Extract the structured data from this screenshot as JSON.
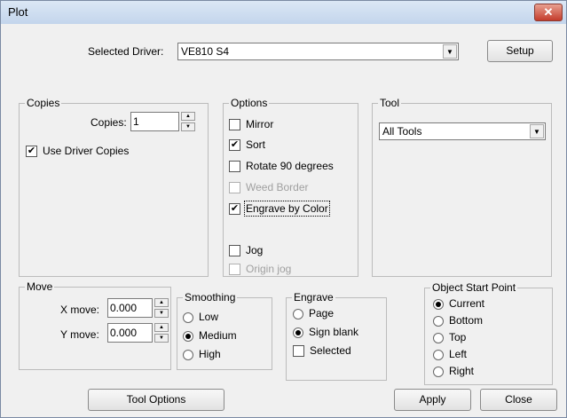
{
  "window": {
    "title": "Plot",
    "close_glyph": "✕"
  },
  "driver": {
    "label": "Selected Driver:",
    "value": "VE810 S4",
    "setup_label": "Setup"
  },
  "copies": {
    "group_label": "Copies",
    "copies_label": "Copies:",
    "copies_value": "1",
    "use_driver_copies_label": "Use Driver Copies",
    "use_driver_copies_checked": true
  },
  "options": {
    "group_label": "Options",
    "mirror": "Mirror",
    "sort": "Sort",
    "rotate": "Rotate 90 degrees",
    "weed_border": "Weed Border",
    "engrave_by_color": "Engrave by Color",
    "jog": "Jog",
    "origin_jog": "Origin jog"
  },
  "tool": {
    "group_label": "Tool",
    "value": "All Tools"
  },
  "move": {
    "group_label": "Move",
    "x_label": "X move:",
    "x_value": "0.000",
    "y_label": "Y move:",
    "y_value": "0.000"
  },
  "smoothing": {
    "group_label": "Smoothing",
    "low": "Low",
    "medium": "Medium",
    "high": "High",
    "selected": "Medium"
  },
  "engrave": {
    "group_label": "Engrave",
    "page": "Page",
    "sign_blank": "Sign blank",
    "selected_label": "Selected",
    "mode": "Sign blank"
  },
  "object_start": {
    "group_label": "Object Start Point",
    "current": "Current",
    "bottom": "Bottom",
    "top": "Top",
    "left": "Left",
    "right": "Right",
    "selected": "Current"
  },
  "buttons": {
    "tool_options": "Tool Options",
    "apply": "Apply",
    "close": "Close"
  },
  "glyphs": {
    "check": "✔",
    "down": "▼",
    "up": "▲"
  }
}
